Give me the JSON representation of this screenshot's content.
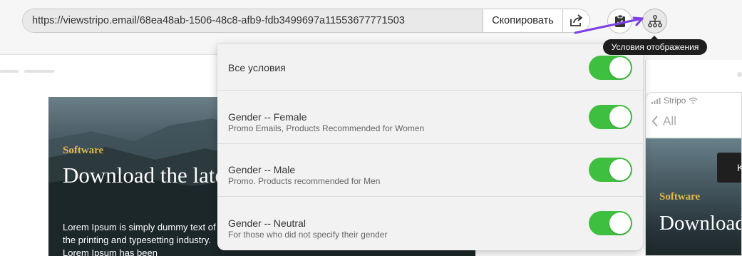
{
  "toolbar": {
    "url": "https://viewstripo.email/68ea48ab-1506-48c8-afb9-fdb3499697a11553677771503",
    "copy_label": "Скопировать",
    "share_icon": "share-icon",
    "clipboard_icon": "clipboard-check-icon",
    "conditions_icon": "hierarchy-icon",
    "tooltip": "Условия отображения"
  },
  "conditions": {
    "items": [
      {
        "title": "Все условия",
        "description": "",
        "enabled": true
      },
      {
        "title": "Gender -- Female",
        "description": "Promo Emails, Products Recommended for Women",
        "enabled": true
      },
      {
        "title": "Gender -- Male",
        "description": "Promo. Products recommended for Men",
        "enabled": true
      },
      {
        "title": "Gender -- Neutral",
        "description": "For those who did not specify their gender",
        "enabled": true
      }
    ]
  },
  "desktop_preview": {
    "kicker": "Software",
    "title": "Download the latest version of software",
    "body": "Lorem Ipsum is simply dummy text of the printing and typesetting industry. Lorem Ipsum has been"
  },
  "mobile_preview": {
    "carrier": "Stripo",
    "back_label": "All",
    "kicker": "Software",
    "title": "Download the version of",
    "button_label": "K"
  },
  "colors": {
    "toggle_on": "#3fbf3f",
    "accent_gold": "#e2b84a",
    "arrow": "#7b3fe4"
  }
}
